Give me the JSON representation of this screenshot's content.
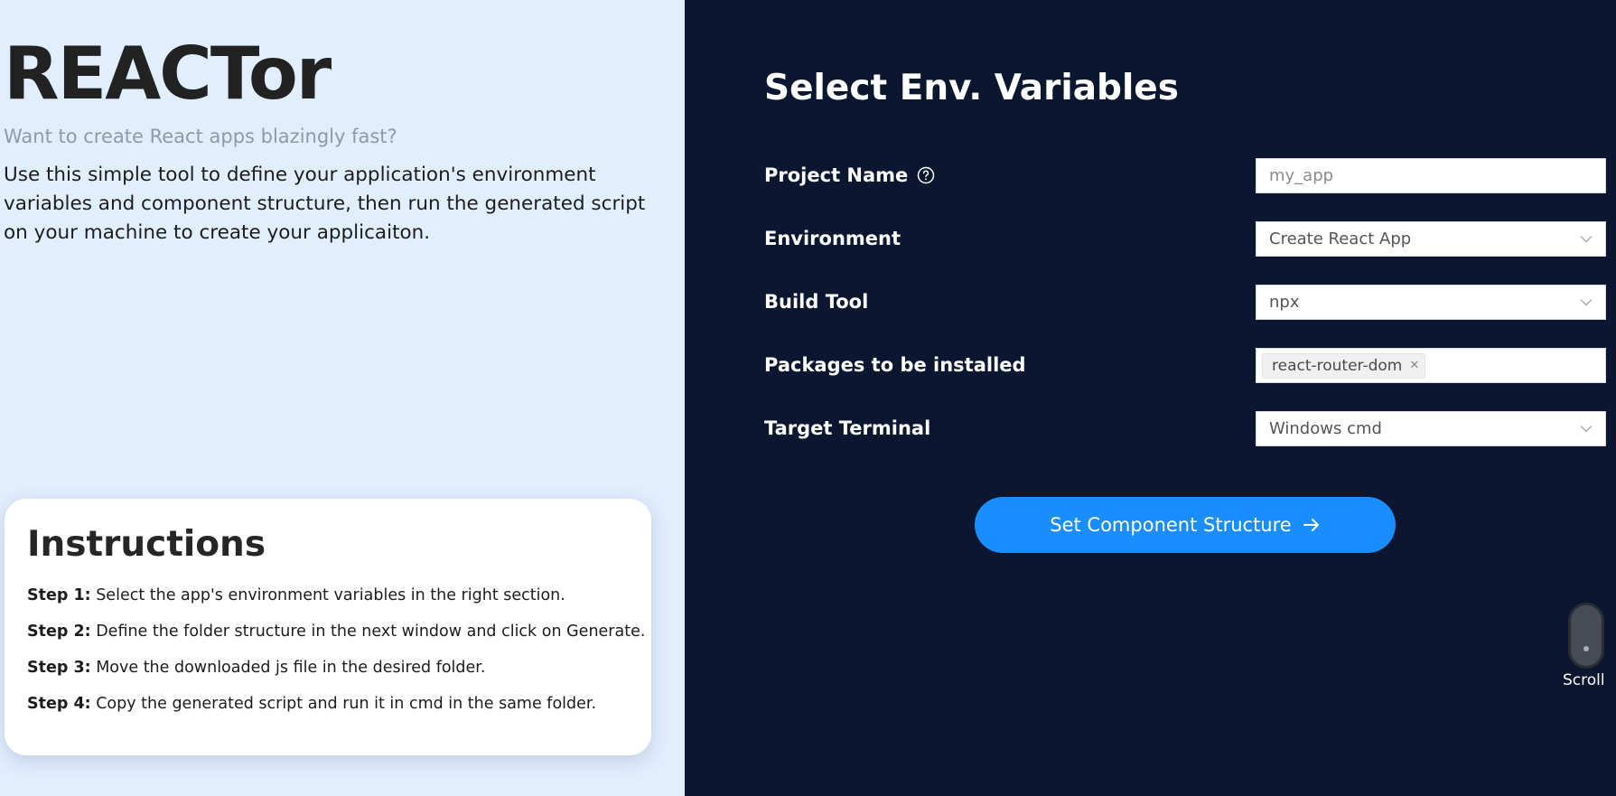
{
  "brand": {
    "name": "REACTor",
    "tagline": "Want to create React apps blazingly fast?",
    "description": "Use this simple tool to define your application's environment variables and component structure, then run the generated script on your machine to create your applicaiton."
  },
  "instructions": {
    "title": "Instructions",
    "steps": [
      {
        "label": "Step 1:",
        "text": " Select the app's environment variables in the right section."
      },
      {
        "label": "Step 2:",
        "text": " Define the folder structure in the next window and click on Generate."
      },
      {
        "label": "Step 3:",
        "text": " Move the downloaded js file in the desired folder."
      },
      {
        "label": "Step 4:",
        "text": " Copy the generated script and run it in cmd in the same folder."
      }
    ]
  },
  "form": {
    "title": "Select Env. Variables",
    "project_name": {
      "label": "Project Name",
      "placeholder": "my_app",
      "help_icon": "question-circle-icon"
    },
    "environment": {
      "label": "Environment",
      "value": "Create React App"
    },
    "build_tool": {
      "label": "Build Tool",
      "value": "npx"
    },
    "packages": {
      "label": "Packages to be installed",
      "tags": [
        "react-router-dom"
      ]
    },
    "target_terminal": {
      "label": "Target Terminal",
      "value": "Windows cmd"
    },
    "submit_label": "Set Component Structure",
    "submit_icon": "arrow-right-icon"
  },
  "scroll_hint": {
    "label": "Scroll",
    "icon": "mouse-icon"
  },
  "colors": {
    "left_background": "#e1eefe",
    "right_background": "#0b1730",
    "accent": "#1a8eff",
    "muted_text": "#8e9aaa"
  }
}
